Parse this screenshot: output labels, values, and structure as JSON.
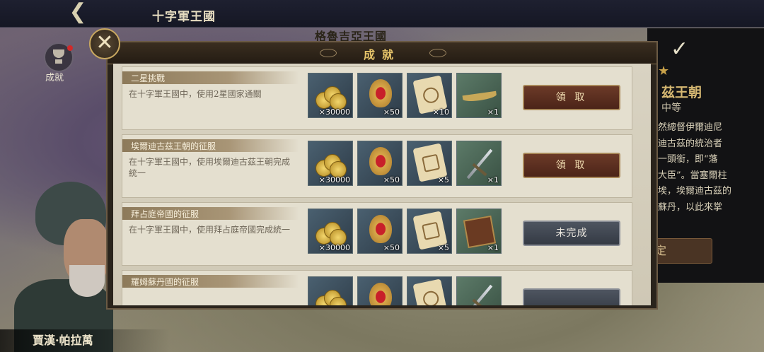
{
  "topbar": {
    "title": "十字軍王國"
  },
  "map": {
    "kingdom_label": "格魯吉亞王國"
  },
  "sidebar": {
    "achievements_label": "成就"
  },
  "modal": {
    "title": "成就",
    "close_icon": "close-x-icon"
  },
  "rows": [
    {
      "title": "二星挑戰",
      "description": "在十字軍王國中，使用2星國家通關",
      "rewards": [
        {
          "icon": "gold-coins-icon",
          "qty": "×30000"
        },
        {
          "icon": "medal-badge-icon",
          "qty": "×50"
        },
        {
          "icon": "map-scroll-icon",
          "qty": "×10"
        },
        {
          "icon": "horn-icon",
          "qty": "×1"
        }
      ],
      "button": "領 取",
      "button_state": "claimable"
    },
    {
      "title": "埃爾迪古茲王朝的征服",
      "description": "在十字軍王國中，使用埃爾迪古茲王朝完成統一",
      "rewards": [
        {
          "icon": "gold-coins-icon",
          "qty": "×30000"
        },
        {
          "icon": "medal-badge-icon",
          "qty": "×50"
        },
        {
          "icon": "blueprint-scroll-icon",
          "qty": "×5"
        },
        {
          "icon": "sword-icon",
          "qty": "×1"
        }
      ],
      "button": "領 取",
      "button_state": "claimable"
    },
    {
      "title": "拜占庭帝國的征服",
      "description": "在十字軍王國中，使用拜占庭帝國完成統一",
      "rewards": [
        {
          "icon": "gold-coins-icon",
          "qty": "×30000"
        },
        {
          "icon": "medal-badge-icon",
          "qty": "×50"
        },
        {
          "icon": "blueprint-scroll-icon",
          "qty": "×5"
        },
        {
          "icon": "book-icon",
          "qty": "×1"
        }
      ],
      "button": "未完成",
      "button_state": "incomplete"
    },
    {
      "title": "羅姆蘇丹國的征服",
      "description": "",
      "rewards": [
        {
          "icon": "gold-coins-icon",
          "qty": ""
        },
        {
          "icon": "medal-badge-icon",
          "qty": ""
        },
        {
          "icon": "map-scroll-icon",
          "qty": ""
        },
        {
          "icon": "sword-icon",
          "qty": ""
        }
      ],
      "button": "",
      "button_state": "incomplete"
    }
  ],
  "side_panel": {
    "name": "茲王朝",
    "subtitle": "中等",
    "text": [
      "然總督伊爾迪尼",
      "迪古茲的統治者",
      "一頭銜，即“藩",
      "大臣”。當塞爾柱",
      "埃，埃爾迪古茲的",
      "蘇丹，以此來掌"
    ],
    "button": "定"
  },
  "character": {
    "name": "賈漢·帕拉萬"
  },
  "colors": {
    "claim": "#5a2e1f",
    "incomplete": "#3f4650",
    "gold_title": "#e6c46a"
  }
}
